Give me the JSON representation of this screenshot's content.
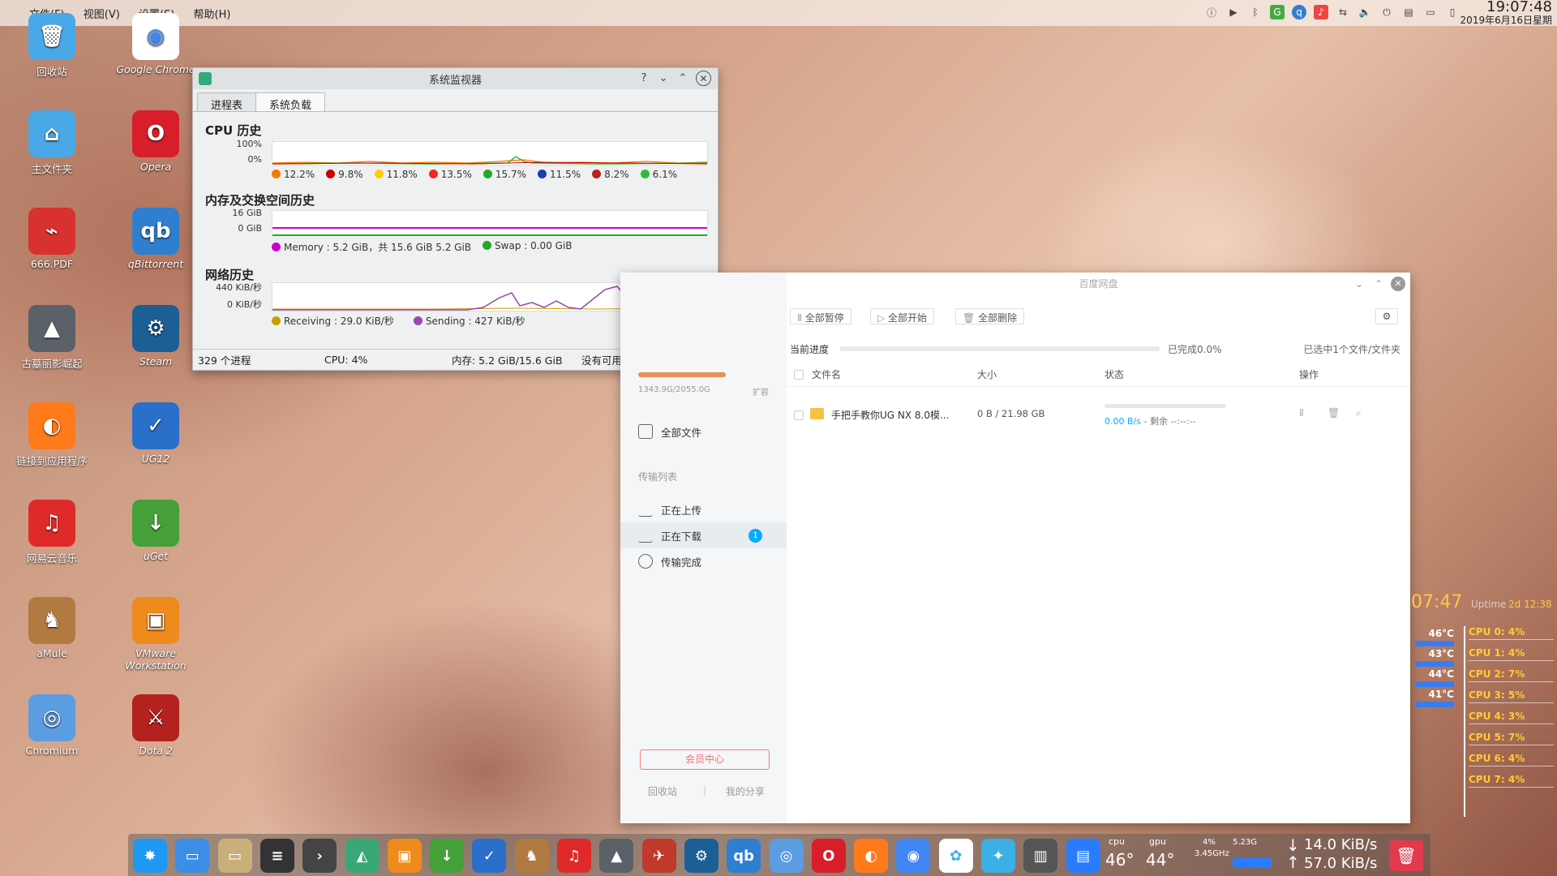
{
  "topbar": {
    "menus": [
      "文件(F)",
      "视图(V)",
      "设置(S)",
      "帮助(H)"
    ],
    "time": "19:07:48",
    "date": "2019年6月16日星期"
  },
  "desktop_icons": [
    {
      "label": "回收站",
      "color": "#49a9e8",
      "glyph": "🗑"
    },
    {
      "label": "Google Chrome",
      "color": "#ffffff",
      "glyph": "◉"
    },
    {
      "label": "主文件夹",
      "color": "#4aa8e6",
      "glyph": "⌂"
    },
    {
      "label": "Opera",
      "color": "#d81e2a",
      "glyph": "O"
    },
    {
      "label": "666.PDF",
      "color": "#d93030",
      "glyph": "⌁"
    },
    {
      "label": "qBittorrent",
      "color": "#2f7fd0",
      "glyph": "qb"
    },
    {
      "label": "古墓丽影崛起",
      "color": "#5a6168",
      "glyph": "▲"
    },
    {
      "label": "Steam",
      "color": "#1c5f95",
      "glyph": "⚙"
    },
    {
      "label": "链接到应用程序",
      "color": "#ff7a1a",
      "glyph": "◐"
    },
    {
      "label": "UG12",
      "color": "#2a6fc9",
      "glyph": "✓"
    },
    {
      "label": "网易云音乐",
      "color": "#e02a2a",
      "glyph": "♫"
    },
    {
      "label": "uGet",
      "color": "#45a03a",
      "glyph": "↓"
    },
    {
      "label": "aMule",
      "color": "#b07a40",
      "glyph": "♞"
    },
    {
      "label": "VMware Workstation",
      "color": "#ef8a1d",
      "glyph": "▣"
    },
    {
      "label": "Chromium",
      "color": "#5c9ce0",
      "glyph": "◎"
    },
    {
      "label": "Dota 2",
      "color": "#b3221e",
      "glyph": "⚔"
    }
  ],
  "sysmon": {
    "title": "系统监视器",
    "tabs": [
      "进程表",
      "系统负载"
    ],
    "cpu": {
      "title": "CPU 历史",
      "y_top": "100%",
      "y_bottom": "0%",
      "legend": [
        {
          "label": "12.2%",
          "color": "#f57900"
        },
        {
          "label": "9.8%",
          "color": "#cc0000"
        },
        {
          "label": "11.8%",
          "color": "#ffcc00"
        },
        {
          "label": "13.5%",
          "color": "#ef2929"
        },
        {
          "label": "15.7%",
          "color": "#22aa22"
        },
        {
          "label": "11.5%",
          "color": "#1a3fb0"
        },
        {
          "label": "8.2%",
          "color": "#bb2222"
        },
        {
          "label": "6.1%",
          "color": "#33bb33"
        }
      ]
    },
    "mem": {
      "title": "内存及交换空间历史",
      "y_top": "16 GiB",
      "y_bottom": "0 GiB",
      "memory_label": "Memory : 5.2 GiB，共 15.6 GiB 5.2 GiB",
      "swap_label": "Swap : 0.00 GiB",
      "memory_color": "#cc00cc",
      "swap_color": "#22aa22"
    },
    "net": {
      "title": "网络历史",
      "y_top": "440 KiB/秒",
      "y_bottom": "0 KiB/秒",
      "recv_label": "Receiving : 29.0 KiB/秒",
      "send_label": "Sending : 427 KiB/秒",
      "recv_color": "#c4a000",
      "send_color": "#9b44b0"
    },
    "status": {
      "processes": "329 个进程",
      "cpu": "CPU: 4%",
      "mem": "内存: 5.2 GiB/15.6 GiB",
      "swap": "没有可用的交换空间"
    }
  },
  "baidu": {
    "title": "百度网盘",
    "storage": "1343.9G/2055.0G",
    "expand": "扩容",
    "all_files": "全部文件",
    "transfer_list": "传输列表",
    "uploading": "正在上传",
    "downloading": "正在下载",
    "download_count": "1",
    "completed": "传输完成",
    "vip": "会员中心",
    "recycle": "回收站",
    "share": "我的分享",
    "btn_pause_all": "全部暂停",
    "btn_start_all": "全部开始",
    "btn_delete_all": "全部删除",
    "progress_label": "当前进度",
    "progress_done": "已完成0.0%",
    "selected": "已选中1个文件/文件夹",
    "cols": [
      "文件名",
      "大小",
      "状态",
      "操作"
    ],
    "file": {
      "name": "手把手教你UG NX 8.0模...",
      "size": "0 B / 21.98 GB",
      "speed": "0.00 B/s",
      "remain": "- 剩余 --:--:--"
    }
  },
  "conky": {
    "time": "07:47",
    "uptime_label": "Uptime",
    "uptime": "2d 12:38",
    "temps": [
      "46°C",
      "43°C",
      "44°C",
      "41°C"
    ],
    "cpus": [
      "CPU 0: 4%",
      "CPU 1: 4%",
      "CPU 2: 7%",
      "CPU 3: 5%",
      "CPU 4: 3%",
      "CPU 5: 7%",
      "CPU 6: 4%",
      "CPU 7: 4%"
    ]
  },
  "dock": {
    "cpu_label": "cpu",
    "cpu_temp": "46°",
    "gpu_label": "gpu",
    "gpu_temp": "44°",
    "cpu_pct": "4%",
    "freq": "3.45GHz",
    "mem": "5.23G",
    "down": "14.0 KiB/s",
    "up": "57.0 KiB/s",
    "apps": [
      "kde-icon",
      "folder-icon",
      "files-icon",
      "settings-icon",
      "terminal-icon",
      "monitor-icon",
      "vmware-icon",
      "uget-icon",
      "ug-icon",
      "amule-icon",
      "netease-icon",
      "tombraider-icon",
      "racing-icon",
      "steam-icon",
      "qbittorrent-icon",
      "chromium-icon",
      "opera-icon",
      "firefox-icon",
      "chrome-icon",
      "baidu-icon",
      "bird-icon",
      "archive-icon",
      "text-icon"
    ]
  }
}
